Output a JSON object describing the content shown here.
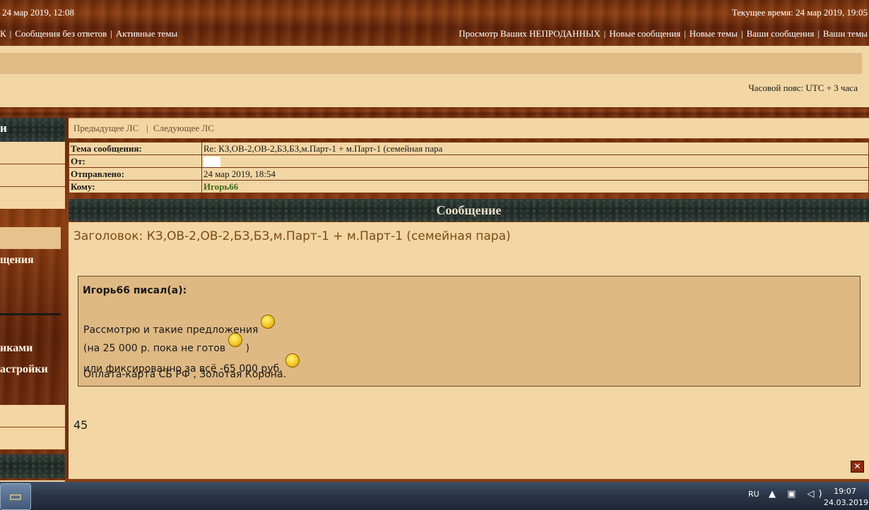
{
  "topbar": {
    "last_visit": "24 мар 2019, 12:08",
    "current_time": "Текущее время: 24 мар 2019, 19:05",
    "nav_left": [
      "К",
      "Сообщения без ответов",
      "Активные темы"
    ],
    "nav_right": [
      "Просмотр Ваших НЕПРОДАННЫХ",
      "Новые сообщения",
      "Новые темы",
      "Ваши сообщения",
      "Ваши темы"
    ]
  },
  "timezone": "Часовой пояс: UTC + 3 часа",
  "sidebar": {
    "header_fragment": "и",
    "item_fragment_1": "щения",
    "item_fragment_2": "иками",
    "item_fragment_3": "астройки"
  },
  "pm_nav": {
    "prev": "Предыдущее ЛС",
    "separator": "|",
    "next": "Следующее ЛС"
  },
  "headers": {
    "subject_label": "Тема сообщения:",
    "subject_value": "Re: КЗ,ОВ-2,ОВ-2,БЗ,БЗ,м.Парт-1 + м.Парт-1 (семейная пара",
    "from_label": "От:",
    "sent_label": "Отправлено:",
    "sent_value": "24 мар 2019, 18:54",
    "to_label": "Кому:",
    "to_value": "Игорь66"
  },
  "message": {
    "header": "Сообщение",
    "subject_line": "Заголовок: КЗ,ОВ-2,ОВ-2,БЗ,БЗ,м.Парт-1 + м.Парт-1 (семейная пара)",
    "quote_author": "Игорь66 писал(а):",
    "quote_lines": [
      "Рассмотрю и такие предложения",
      "(на 25 000 р. пока не готов",
      "или фиксированно за всё -65 000 руб.",
      "Оплата-карта СБ РФ , Золотая Корона."
    ],
    "quote_line2_suffix": ")",
    "number": "45",
    "close_glyph": "✕"
  },
  "taskbar": {
    "lang": "RU",
    "icons_glyphs": "▲ ▣ ◁)",
    "time": "19:07",
    "date": "24.03.2019"
  },
  "colors": {
    "wood": "#7a3410",
    "panel": "#f2d6a4",
    "quote_bg": "#dfb983",
    "link_green": "#3f6b1a"
  }
}
